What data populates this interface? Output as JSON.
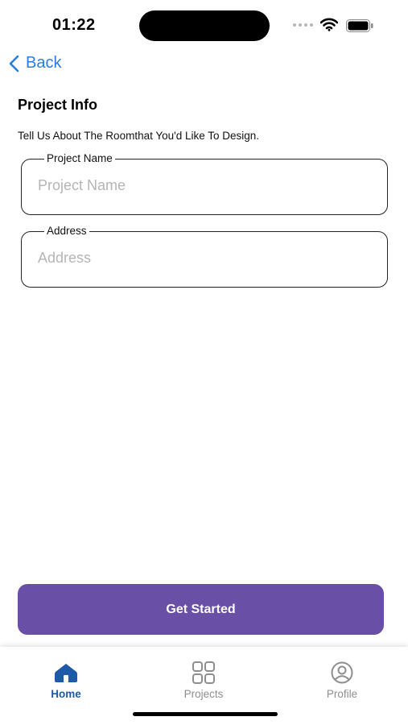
{
  "status_bar": {
    "time": "01:22"
  },
  "nav": {
    "back_label": "Back"
  },
  "form": {
    "title": "Project Info",
    "description": "Tell Us About The Roomthat You'd Like To Design.",
    "fields": [
      {
        "label": "Project Name",
        "placeholder": "Project Name",
        "value": ""
      },
      {
        "label": "Address",
        "placeholder": "Address",
        "value": ""
      }
    ]
  },
  "actions": {
    "primary_label": "Get Started"
  },
  "tab_bar": {
    "items": [
      {
        "label": "Home",
        "icon": "home-icon",
        "active": true
      },
      {
        "label": "Projects",
        "icon": "grid-icon",
        "active": false
      },
      {
        "label": "Profile",
        "icon": "profile-icon",
        "active": false
      }
    ]
  },
  "colors": {
    "accent_blue": "#2a7de1",
    "primary_button": "#6a4fa6",
    "active_tab": "#1e5aa8",
    "inactive_tab": "#8e8e8e"
  }
}
